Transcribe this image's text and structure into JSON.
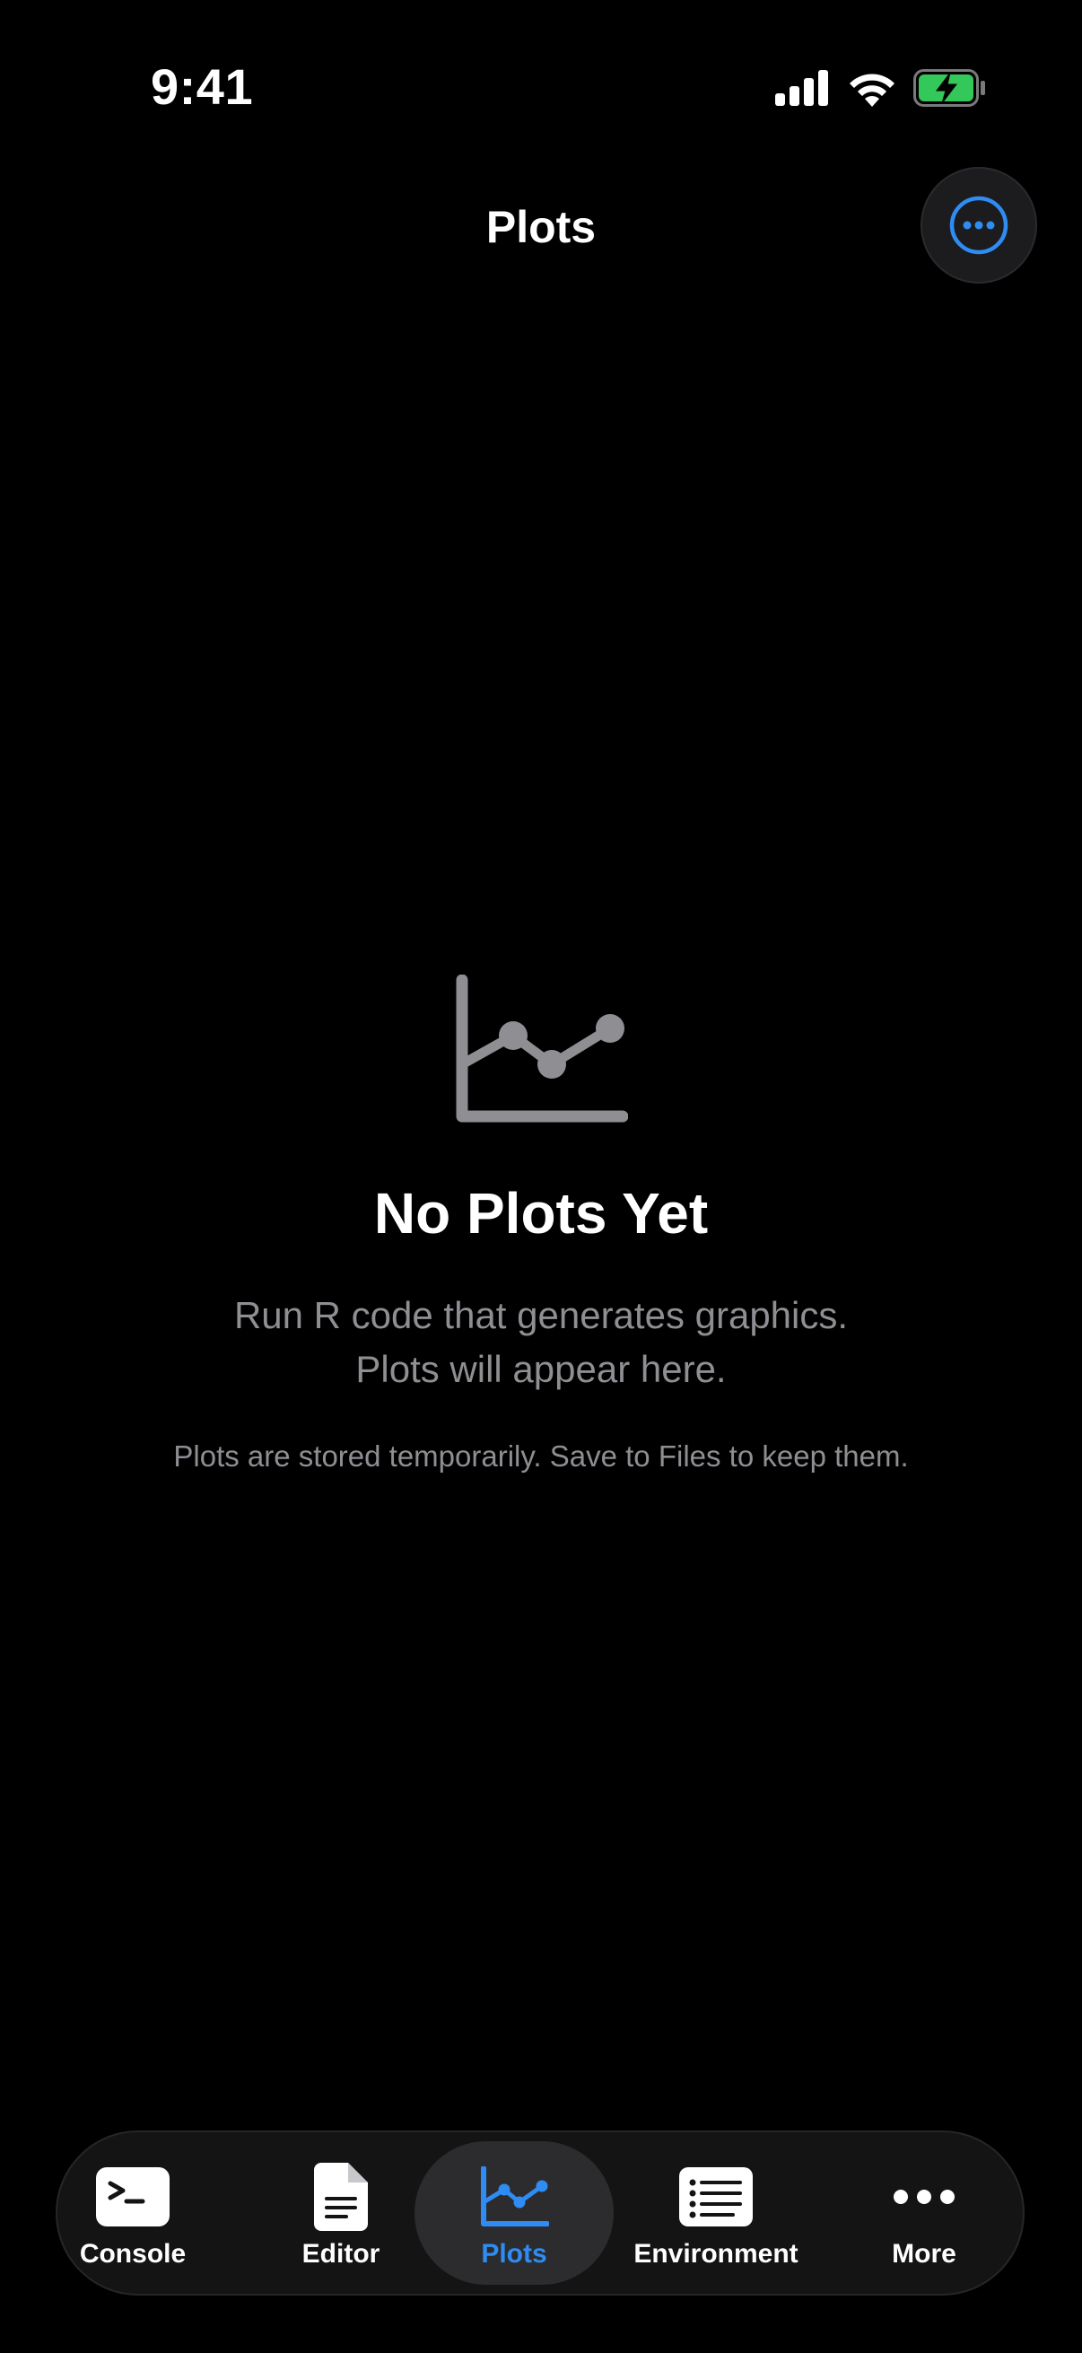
{
  "status_bar": {
    "time": "9:41"
  },
  "header": {
    "title": "Plots",
    "more_icon": "ellipsis-circle-icon"
  },
  "empty_state": {
    "icon": "line-chart-icon",
    "title": "No Plots Yet",
    "description_line1": "Run R code that generates graphics.",
    "description_line2": "Plots will appear here.",
    "note": "Plots are stored temporarily. Save to Files to keep them."
  },
  "tab_bar": {
    "active_tab": "Plots",
    "items": [
      {
        "label": "Console",
        "icon": "terminal-icon"
      },
      {
        "label": "Editor",
        "icon": "document-icon"
      },
      {
        "label": "Plots",
        "icon": "line-chart-icon"
      },
      {
        "label": "Environment",
        "icon": "list-icon"
      },
      {
        "label": "More",
        "icon": "ellipsis-icon"
      }
    ]
  },
  "colors": {
    "accent": "#2f8cf2",
    "background": "#000000",
    "secondary_text": "#8e8e93",
    "battery": "#34c759"
  }
}
